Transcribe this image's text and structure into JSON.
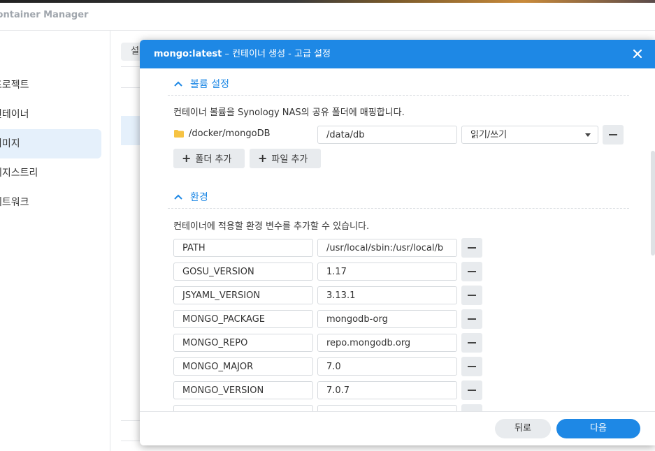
{
  "app": {
    "title": "Container Manager",
    "sidebar": [
      "프로젝트",
      "컨테이너",
      "이미지",
      "레지스트리",
      "네트워크"
    ],
    "bg_button": "설"
  },
  "dialog": {
    "title_bold": "mongo:latest",
    "title_rest": " – 컨테이너 생성 - 고급 설정",
    "volume": {
      "heading": "볼륨 설정",
      "description": "컨테이너 볼륨을 Synology NAS의 공유 폴더에 매핑합니다.",
      "rows": [
        {
          "folder": "/docker/mongoDB",
          "mount": "/data/db",
          "mode": "읽기/쓰기"
        }
      ],
      "add_folder": "폴더 추가",
      "add_file": "파일 추가"
    },
    "env": {
      "heading": "환경",
      "description": "컨테이너에 적용할 환경 변수를 추가할 수 있습니다.",
      "vars": [
        {
          "key": "PATH",
          "value": "/usr/local/sbin:/usr/local/b"
        },
        {
          "key": "GOSU_VERSION",
          "value": "1.17"
        },
        {
          "key": "JSYAML_VERSION",
          "value": "3.13.1"
        },
        {
          "key": "MONGO_PACKAGE",
          "value": "mongodb-org"
        },
        {
          "key": "MONGO_REPO",
          "value": "repo.mongodb.org"
        },
        {
          "key": "MONGO_MAJOR",
          "value": "7.0"
        },
        {
          "key": "MONGO_VERSION",
          "value": "7.0.7"
        }
      ]
    },
    "footer": {
      "back": "뒤로",
      "next": "다음"
    }
  },
  "colors": {
    "accent": "#1e88e5",
    "sidebar_active": "#e5f0fb"
  },
  "icons": [
    "close-icon",
    "chevron-up-icon",
    "folder-icon",
    "plus-icon",
    "minus-icon",
    "dropdown-arrow-icon"
  ]
}
